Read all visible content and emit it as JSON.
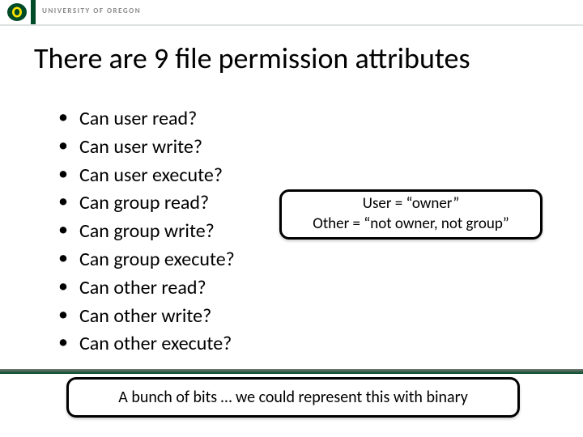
{
  "header": {
    "institution": "UNIVERSITY OF OREGON"
  },
  "title": "There are 9 file permission attributes",
  "bullets": [
    "Can user read?",
    "Can user write?",
    "Can user execute?",
    "Can group read?",
    "Can group write?",
    "Can group execute?",
    "Can other read?",
    "Can other write?",
    "Can other execute?"
  ],
  "defs_box": {
    "line1": "User = “owner”",
    "line2": "Other = “not owner, not group”"
  },
  "footer_box": "A bunch of bits … we could represent this with binary"
}
